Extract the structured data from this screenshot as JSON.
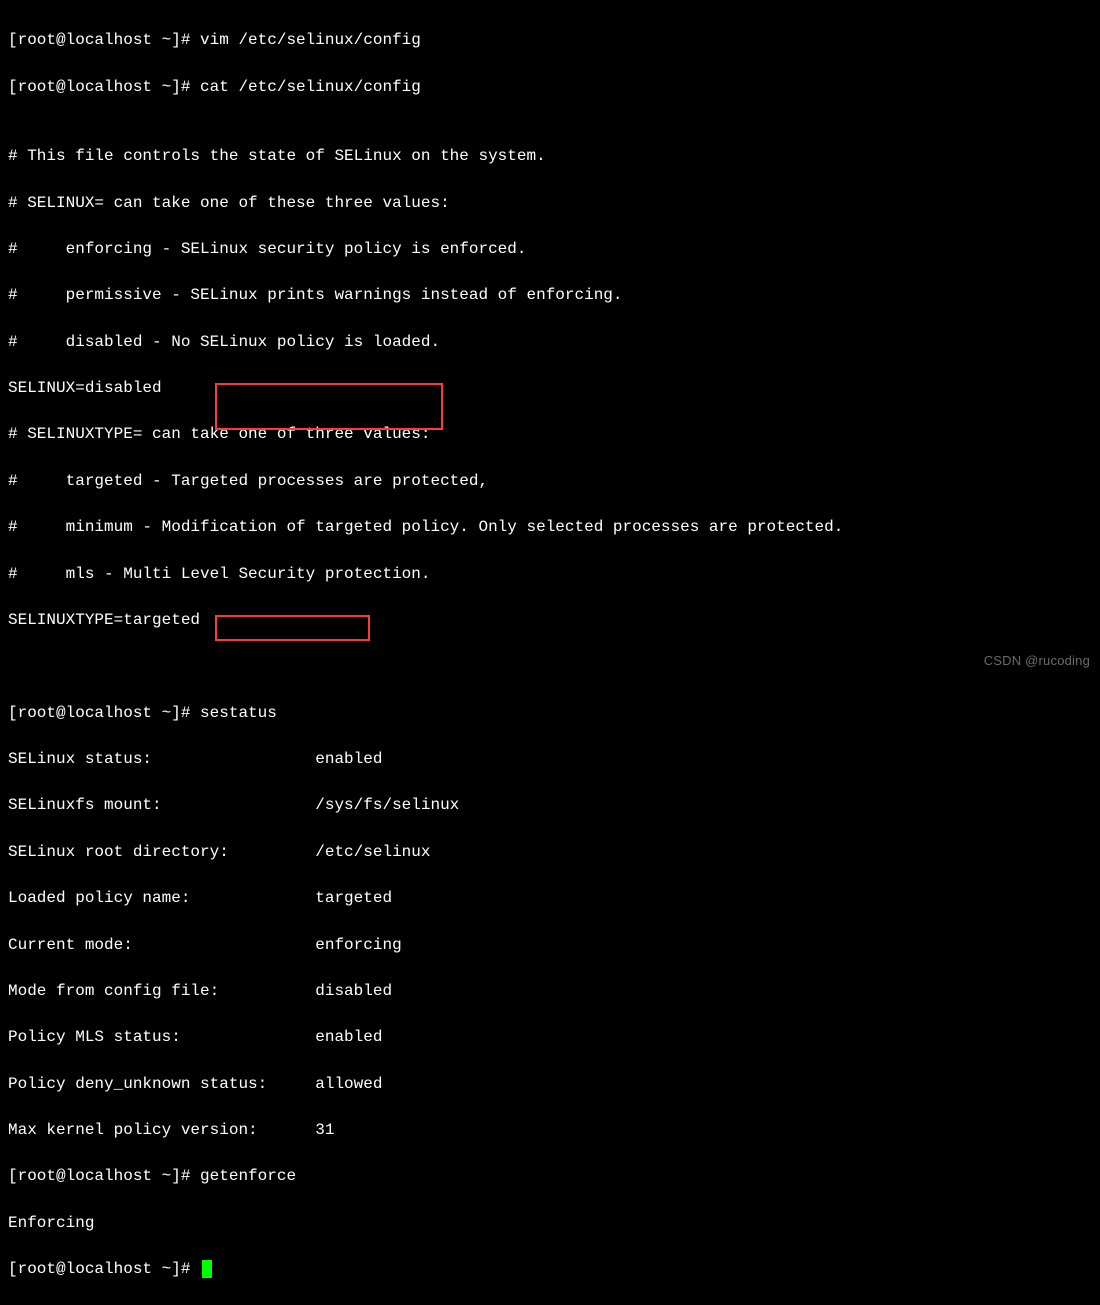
{
  "prompt": "[root@localhost ~]# ",
  "commands": {
    "vim": "vim /etc/selinux/config",
    "cat": "cat /etc/selinux/config",
    "sestatus": "sestatus",
    "getenforce": "getenforce"
  },
  "config_output": {
    "blank1": "",
    "l1": "# This file controls the state of SELinux on the system.",
    "l2": "# SELINUX= can take one of these three values:",
    "l3": "#     enforcing - SELinux security policy is enforced.",
    "l4": "#     permissive - SELinux prints warnings instead of enforcing.",
    "l5": "#     disabled - No SELinux policy is loaded.",
    "l6": "SELINUX=disabled",
    "l7": "# SELINUXTYPE= can take one of three values:",
    "l8": "#     targeted - Targeted processes are protected,",
    "l9": "#     minimum - Modification of targeted policy. Only selected processes are protected.",
    "l10": "#     mls - Multi Level Security protection.",
    "l11": "SELINUXTYPE=targeted",
    "blank2": "",
    "blank3": ""
  },
  "sestatus_output": {
    "r1": "SELinux status:                 enabled",
    "r2": "SELinuxfs mount:                /sys/fs/selinux",
    "r3": "SELinux root directory:         /etc/selinux",
    "r4": "Loaded policy name:             targeted",
    "r5": "Current mode:                   enforcing",
    "r6": "Mode from config file:          disabled",
    "r7": "Policy MLS status:              enabled",
    "r8": "Policy deny_unknown status:     allowed",
    "r9": "Max kernel policy version:      31"
  },
  "getenforce_output": "Enforcing",
  "watermark": "CSDN @rucoding",
  "highlight_box_color": "#ff3b30",
  "cursor_color": "#00ff00"
}
